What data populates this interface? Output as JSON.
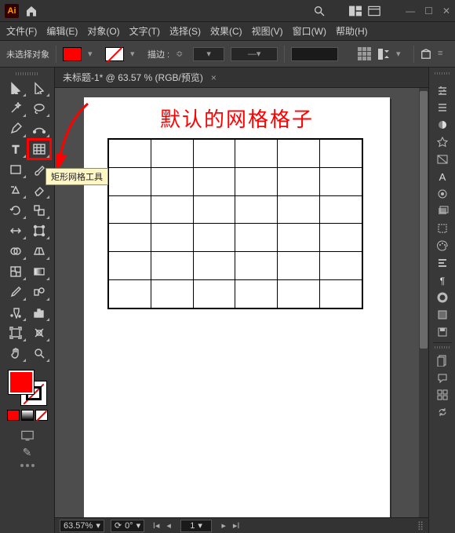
{
  "app": {
    "logo": "Ai"
  },
  "menu": [
    "文件(F)",
    "编辑(E)",
    "对象(O)",
    "文字(T)",
    "选择(S)",
    "效果(C)",
    "视图(V)",
    "窗口(W)",
    "帮助(H)"
  ],
  "ctrl": {
    "selection": "未选择对象",
    "stroke_label": "描边 :",
    "stroke_dash": "—"
  },
  "doc": {
    "tab_label": "未标题-1* @ 63.57 % (RGB/预览)",
    "close": "×"
  },
  "artboard": {
    "title": "默认的网格格子",
    "grid_rows": 6,
    "grid_cols": 6
  },
  "tooltip": "矩形网格工具",
  "status": {
    "zoom": "63.57%",
    "rotate": "0°",
    "page": "1"
  },
  "tool_names": [
    "selection-tool",
    "direct-selection-tool",
    "magic-wand-tool",
    "lasso-tool",
    "pen-tool",
    "curvature-tool",
    "type-tool",
    "rectangular-grid-tool",
    "rectangle-tool",
    "paintbrush-tool",
    "shaper-tool",
    "eraser-tool",
    "rotate-tool",
    "scale-tool",
    "width-tool",
    "free-transform-tool",
    "shape-builder-tool",
    "perspective-grid-tool",
    "mesh-tool",
    "gradient-tool",
    "eyedropper-tool",
    "blend-tool",
    "symbol-sprayer-tool",
    "column-graph-tool",
    "artboard-tool",
    "slice-tool",
    "hand-tool",
    "zoom-tool"
  ],
  "right_panel_names": [
    "properties-icon",
    "menu-lines-icon",
    "color-icon",
    "color-guide-icon",
    "swatches-icon",
    "character-a-icon",
    "appearance-circle-icon",
    "layers-icon",
    "transform-icon",
    "palette-icon",
    "align-icon",
    "paragraph-icon",
    "stroke-icon",
    "opacity-icon",
    "save-icon",
    "gap",
    "libraries-icon",
    "chat-icon",
    "arrange-icon",
    "sync-icon"
  ]
}
